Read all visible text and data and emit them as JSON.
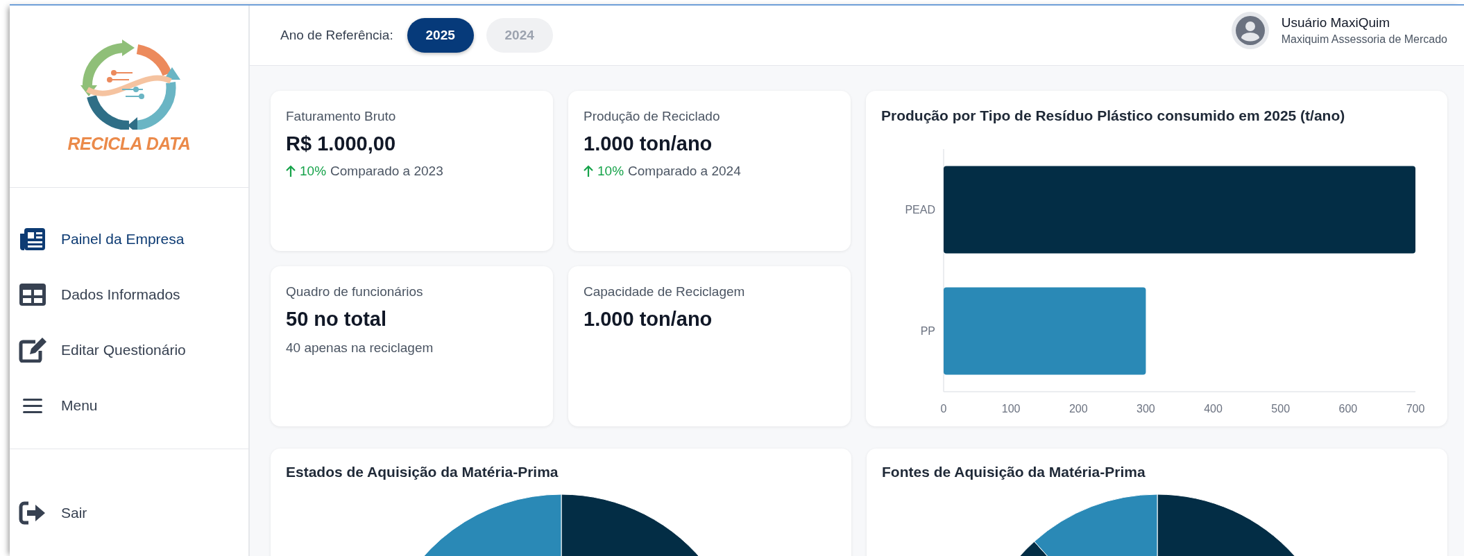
{
  "sidebar": {
    "logo_text": "RECICLA DATA",
    "nav": [
      {
        "label": "Painel da Empresa",
        "selected": true
      },
      {
        "label": "Dados Informados",
        "selected": false
      },
      {
        "label": "Editar Questionário",
        "selected": false
      },
      {
        "label": "Menu",
        "selected": false
      }
    ],
    "footer": [
      {
        "label": "Sair",
        "selected": false
      }
    ]
  },
  "header": {
    "year_label": "Ano de Referência:",
    "years": [
      {
        "label": "2025",
        "selected": true
      },
      {
        "label": "2024",
        "selected": false
      }
    ],
    "user": {
      "name": "Usuário MaxiQuim",
      "company": "Maxiquim Assessoria de Mercado"
    }
  },
  "kpis": [
    {
      "title": "Faturamento Bruto",
      "value": "R$ 1.000,00",
      "trend": {
        "percent": "10%",
        "text": "Comparado a 2023"
      }
    },
    {
      "title": "Produção de Reciclado",
      "value": "1.000 ton/ano",
      "trend": {
        "percent": "10%",
        "text": "Comparado a 2024"
      }
    },
    {
      "title": "Quadro de funcionários",
      "value": "50 no total",
      "note": "40 apenas na reciclagem"
    },
    {
      "title": "Capacidade de Reciclagem",
      "value": "1.000 ton/ano"
    }
  ],
  "bar_chart": {
    "chart_data": {
      "type": "bar",
      "title": "Produção por Tipo de Resíduo Plástico consumido em 2025 (t/ano)",
      "orientation": "horizontal",
      "categories": [
        "PEAD",
        "PP"
      ],
      "values": [
        700,
        300
      ],
      "xlim": [
        0,
        700
      ],
      "xticks": [
        0,
        100,
        200,
        300,
        400,
        500,
        600,
        700
      ]
    }
  },
  "pie_cards": [
    {
      "title": "Estados de Aquisição da Matéria-Prima",
      "kind": "two-slice"
    },
    {
      "title": "Fontes de Aquisição da Matéria-Prima",
      "kind": "three-slice"
    }
  ]
}
